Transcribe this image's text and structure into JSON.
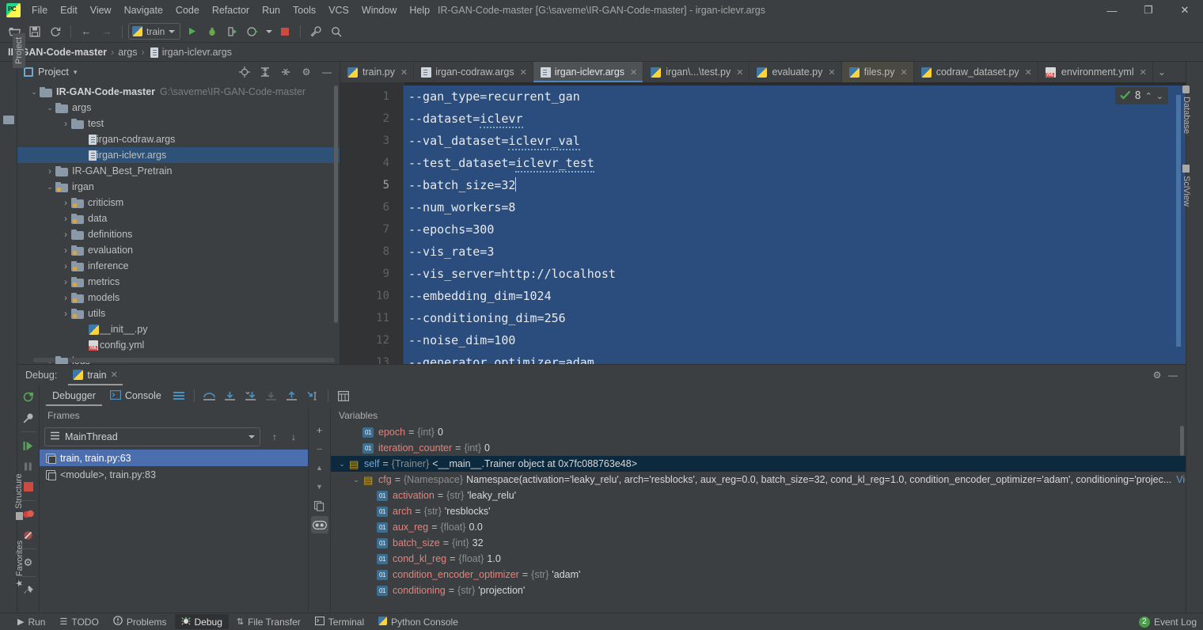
{
  "window": {
    "title": "IR-GAN-Code-master [G:\\saveme\\IR-GAN-Code-master] - irgan-iclevr.args",
    "minimize": "—",
    "maximize": "❐",
    "close": "✕",
    "app_icon": "pycharm-logo"
  },
  "menu": {
    "items": [
      "File",
      "Edit",
      "View",
      "Navigate",
      "Code",
      "Refactor",
      "Run",
      "Tools",
      "VCS",
      "Window",
      "Help"
    ]
  },
  "toolbar": {
    "open_label": "open-folder-icon",
    "save_label": "save-icon",
    "sync_label": "sync-icon",
    "back_label": "←",
    "forward_label": "→",
    "run_config": "train",
    "run_label": "run-icon",
    "debug_label": "debug-icon",
    "run_coverage_label": "run-coverage-icon",
    "profile_label": "profile-icon",
    "stop_label": "stop-icon",
    "settings_label": "wrench-icon",
    "search_label": "search-icon"
  },
  "breadcrumb": {
    "items": [
      "IR-GAN-Code-master",
      "args",
      "irgan-iclevr.args"
    ],
    "separator": "›"
  },
  "project_panel": {
    "title": "Project",
    "dropdown": "▾",
    "actions": [
      "locate-icon",
      "expand-all-icon",
      "collapse-all-icon",
      "gear-icon",
      "hide-icon"
    ],
    "tree": [
      {
        "label": "IR-GAN-Code-master",
        "path": "G:\\saveme\\IR-GAN-Code-master",
        "indent": 0,
        "arrow": "v",
        "icon": "folder",
        "bold": true,
        "selected": false
      },
      {
        "label": "args",
        "path": "",
        "indent": 1,
        "arrow": "v",
        "icon": "folder",
        "bold": false,
        "selected": false
      },
      {
        "label": "test",
        "path": "",
        "indent": 2,
        "arrow": ">",
        "icon": "folder",
        "bold": false,
        "selected": false
      },
      {
        "label": "irgan-codraw.args",
        "path": "",
        "indent": 3,
        "arrow": "",
        "icon": "args",
        "bold": false,
        "selected": false
      },
      {
        "label": "irgan-iclevr.args",
        "path": "",
        "indent": 3,
        "arrow": "",
        "icon": "args",
        "bold": false,
        "selected": true
      },
      {
        "label": "IR-GAN_Best_Pretrain",
        "path": "",
        "indent": 1,
        "arrow": ">",
        "icon": "folder",
        "bold": false,
        "selected": false
      },
      {
        "label": "irgan",
        "path": "",
        "indent": 1,
        "arrow": "v",
        "icon": "folder-mod",
        "bold": false,
        "selected": false
      },
      {
        "label": "criticism",
        "path": "",
        "indent": 2,
        "arrow": ">",
        "icon": "folder-mod",
        "bold": false,
        "selected": false
      },
      {
        "label": "data",
        "path": "",
        "indent": 2,
        "arrow": ">",
        "icon": "folder-mod",
        "bold": false,
        "selected": false
      },
      {
        "label": "definitions",
        "path": "",
        "indent": 2,
        "arrow": ">",
        "icon": "folder",
        "bold": false,
        "selected": false
      },
      {
        "label": "evaluation",
        "path": "",
        "indent": 2,
        "arrow": ">",
        "icon": "folder-mod",
        "bold": false,
        "selected": false
      },
      {
        "label": "inference",
        "path": "",
        "indent": 2,
        "arrow": ">",
        "icon": "folder-mod",
        "bold": false,
        "selected": false
      },
      {
        "label": "metrics",
        "path": "",
        "indent": 2,
        "arrow": ">",
        "icon": "folder-mod",
        "bold": false,
        "selected": false
      },
      {
        "label": "models",
        "path": "",
        "indent": 2,
        "arrow": ">",
        "icon": "folder-mod",
        "bold": false,
        "selected": false
      },
      {
        "label": "utils",
        "path": "",
        "indent": 2,
        "arrow": ">",
        "icon": "folder-mod",
        "bold": false,
        "selected": false
      },
      {
        "label": "__init__.py",
        "path": "",
        "indent": 3,
        "arrow": "",
        "icon": "py",
        "bold": false,
        "selected": false
      },
      {
        "label": "config.yml",
        "path": "",
        "indent": 3,
        "arrow": "",
        "icon": "yml",
        "bold": false,
        "selected": false
      },
      {
        "label": "logs",
        "path": "",
        "indent": 1,
        "arrow": "v",
        "icon": "folder",
        "bold": false,
        "selected": false
      }
    ]
  },
  "left_rail": {
    "tabs": [
      "Project",
      "Structure",
      "Favorites"
    ]
  },
  "right_rail": {
    "tabs": [
      "Database",
      "SciView"
    ]
  },
  "editor": {
    "tabs": [
      {
        "label": "train.py",
        "icon": "py",
        "active": false,
        "modified": false
      },
      {
        "label": "irgan-codraw.args",
        "icon": "args",
        "active": false,
        "modified": false
      },
      {
        "label": "irgan-iclevr.args",
        "icon": "args",
        "active": true,
        "modified": false
      },
      {
        "label": "irgan\\...\\test.py",
        "icon": "py",
        "active": false,
        "modified": false
      },
      {
        "label": "evaluate.py",
        "icon": "py",
        "active": false,
        "modified": false
      },
      {
        "label": "files.py",
        "icon": "py",
        "active": false,
        "modified": true
      },
      {
        "label": "codraw_dataset.py",
        "icon": "py",
        "active": false,
        "modified": false
      },
      {
        "label": "environment.yml",
        "icon": "yml",
        "active": false,
        "modified": false
      }
    ],
    "tab_close": "✕",
    "tabs_overflow": "⌄",
    "current_line": 5,
    "lines": [
      {
        "n": 1,
        "text": "--gan_type=recurrent_gan",
        "warn": ""
      },
      {
        "n": 2,
        "text": "--dataset=",
        "warn": "iclevr"
      },
      {
        "n": 3,
        "text": "--val_dataset=",
        "warn": "iclevr_val"
      },
      {
        "n": 4,
        "text": "--test_dataset=",
        "warn": "iclevr_test"
      },
      {
        "n": 5,
        "text": "--batch_size=32",
        "warn": ""
      },
      {
        "n": 6,
        "text": "--num_workers=8",
        "warn": ""
      },
      {
        "n": 7,
        "text": "--epochs=300",
        "warn": ""
      },
      {
        "n": 8,
        "text": "--vis_rate=3",
        "warn": ""
      },
      {
        "n": 9,
        "text": "--vis_server=http://localhost",
        "warn": ""
      },
      {
        "n": 10,
        "text": "--embedding_dim=1024",
        "warn": ""
      },
      {
        "n": 11,
        "text": "--conditioning_dim=256",
        "warn": ""
      },
      {
        "n": 12,
        "text": "--noise_dim=100",
        "warn": ""
      },
      {
        "n": 13,
        "text": "--generator_optimizer=adam",
        "warn": ""
      }
    ],
    "inspection": {
      "icon": "inspection-ok-icon",
      "count": "8",
      "up": "⌃",
      "down": "⌄"
    }
  },
  "debug": {
    "header_label": "Debug:",
    "session_tab": "train",
    "session_close": "✕",
    "header_actions": [
      "gear-icon",
      "hide-icon"
    ],
    "rail_icons": [
      "rerun-icon",
      "wrench-icon",
      "resume-icon",
      "pause-icon",
      "stop-icon",
      "view-breakpoints-icon",
      "mute-breakpoints-icon",
      "settings-icon",
      "pin-icon"
    ],
    "tabs": [
      {
        "label": "Debugger",
        "icon": "debugger-icon",
        "active": true
      },
      {
        "label": "Console",
        "icon": "console-icon",
        "active": false
      }
    ],
    "toolbar_icons": [
      "layout-icon",
      "step-over-icon",
      "step-into-icon",
      "force-step-into-icon",
      "step-into-my-code-icon",
      "step-out-icon",
      "run-to-cursor-icon",
      "evaluate-expression-icon"
    ],
    "frames": {
      "title": "Frames",
      "thread": "MainThread",
      "thread_icon": "thread-icon",
      "dropdown": "▾",
      "up_arrow": "↑",
      "down_arrow": "↓",
      "rows": [
        {
          "label": "train, train.py:63",
          "selected": true
        },
        {
          "label": "<module>, train.py:83",
          "selected": false
        }
      ]
    },
    "variables": {
      "title": "Variables",
      "side_actions": [
        "add-watch-icon",
        "remove-watch-icon",
        "move-up-icon",
        "move-down-icon",
        "copy-icon",
        "inline-watches-icon"
      ],
      "rows": [
        {
          "indent": 1,
          "arrow": "",
          "badge": "01",
          "badge_kind": "field",
          "name": "epoch",
          "name_color": "red",
          "eq": "=",
          "type": "{int}",
          "value": "0",
          "selected": false,
          "link": ""
        },
        {
          "indent": 1,
          "arrow": "",
          "badge": "01",
          "badge_kind": "field",
          "name": "iteration_counter",
          "name_color": "red",
          "eq": "=",
          "type": "{int}",
          "value": "0",
          "selected": false,
          "link": ""
        },
        {
          "indent": 0,
          "arrow": "v",
          "badge": "obj",
          "badge_kind": "object",
          "name": "self",
          "name_color": "blue",
          "eq": "=",
          "type": "{Trainer}",
          "value": "<__main__.Trainer object at 0x7fc088763e48>",
          "selected": true,
          "link": ""
        },
        {
          "indent": 1,
          "arrow": "v",
          "badge": "obj",
          "badge_kind": "object",
          "name": "cfg",
          "name_color": "red",
          "eq": "=",
          "type": "{Namespace}",
          "value": "Namespace(activation='leaky_relu', arch='resblocks', aux_reg=0.0, batch_size=32, cond_kl_reg=1.0, condition_encoder_optimizer='adam', conditioning='projec...",
          "selected": false,
          "link": "View"
        },
        {
          "indent": 2,
          "arrow": "",
          "badge": "01",
          "badge_kind": "field",
          "name": "activation",
          "name_color": "red",
          "eq": "=",
          "type": "{str}",
          "value": "'leaky_relu'",
          "selected": false,
          "link": ""
        },
        {
          "indent": 2,
          "arrow": "",
          "badge": "01",
          "badge_kind": "field",
          "name": "arch",
          "name_color": "red",
          "eq": "=",
          "type": "{str}",
          "value": "'resblocks'",
          "selected": false,
          "link": ""
        },
        {
          "indent": 2,
          "arrow": "",
          "badge": "01",
          "badge_kind": "field",
          "name": "aux_reg",
          "name_color": "red",
          "eq": "=",
          "type": "{float}",
          "value": "0.0",
          "selected": false,
          "link": ""
        },
        {
          "indent": 2,
          "arrow": "",
          "badge": "01",
          "badge_kind": "field",
          "name": "batch_size",
          "name_color": "red",
          "eq": "=",
          "type": "{int}",
          "value": "32",
          "selected": false,
          "link": ""
        },
        {
          "indent": 2,
          "arrow": "",
          "badge": "01",
          "badge_kind": "field",
          "name": "cond_kl_reg",
          "name_color": "red",
          "eq": "=",
          "type": "{float}",
          "value": "1.0",
          "selected": false,
          "link": ""
        },
        {
          "indent": 2,
          "arrow": "",
          "badge": "01",
          "badge_kind": "field",
          "name": "condition_encoder_optimizer",
          "name_color": "red",
          "eq": "=",
          "type": "{str}",
          "value": "'adam'",
          "selected": false,
          "link": ""
        },
        {
          "indent": 2,
          "arrow": "",
          "badge": "01",
          "badge_kind": "field",
          "name": "conditioning",
          "name_color": "red",
          "eq": "=",
          "type": "{str}",
          "value": "'projection'",
          "selected": false,
          "link": ""
        }
      ]
    }
  },
  "statusbar": {
    "items": [
      {
        "label": "Run",
        "icon": "run-icon",
        "active": false
      },
      {
        "label": "TODO",
        "icon": "todo-icon",
        "active": false
      },
      {
        "label": "Problems",
        "icon": "problems-icon",
        "active": false
      },
      {
        "label": "Debug",
        "icon": "debug-icon",
        "active": true
      },
      {
        "label": "File Transfer",
        "icon": "file-transfer-icon",
        "active": false
      },
      {
        "label": "Terminal",
        "icon": "terminal-icon",
        "active": false
      },
      {
        "label": "Python Console",
        "icon": "python-console-icon",
        "active": false
      }
    ],
    "event_log": {
      "label": "Event Log",
      "count": "2"
    }
  },
  "colors": {
    "accent": "#4a88c7",
    "selection": "#2a4d7d",
    "panel_bg": "#3c3f41",
    "editor_bg": "#2b2b2b",
    "frame_selected": "#4b6eaf",
    "var_name": "#e8807a"
  }
}
